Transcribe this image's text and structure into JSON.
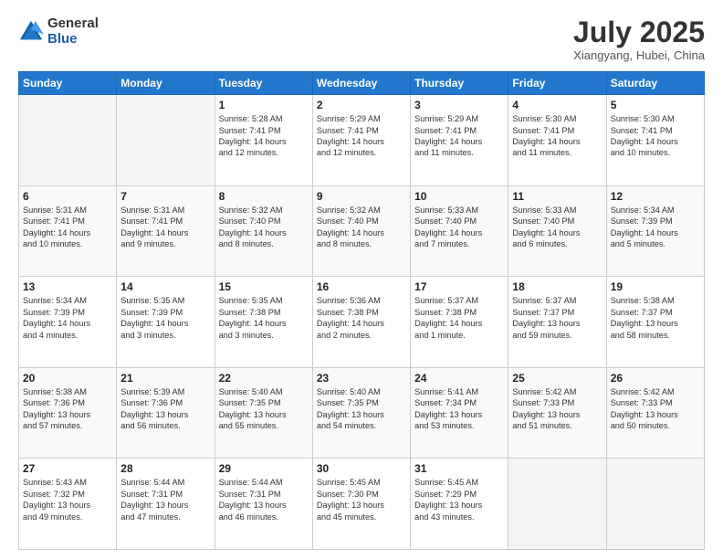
{
  "logo": {
    "general": "General",
    "blue": "Blue"
  },
  "header": {
    "month": "July 2025",
    "location": "Xiangyang, Hubei, China"
  },
  "weekdays": [
    "Sunday",
    "Monday",
    "Tuesday",
    "Wednesday",
    "Thursday",
    "Friday",
    "Saturday"
  ],
  "weeks": [
    [
      {
        "day": "",
        "info": ""
      },
      {
        "day": "",
        "info": ""
      },
      {
        "day": "1",
        "info": "Sunrise: 5:28 AM\nSunset: 7:41 PM\nDaylight: 14 hours\nand 12 minutes."
      },
      {
        "day": "2",
        "info": "Sunrise: 5:29 AM\nSunset: 7:41 PM\nDaylight: 14 hours\nand 12 minutes."
      },
      {
        "day": "3",
        "info": "Sunrise: 5:29 AM\nSunset: 7:41 PM\nDaylight: 14 hours\nand 11 minutes."
      },
      {
        "day": "4",
        "info": "Sunrise: 5:30 AM\nSunset: 7:41 PM\nDaylight: 14 hours\nand 11 minutes."
      },
      {
        "day": "5",
        "info": "Sunrise: 5:30 AM\nSunset: 7:41 PM\nDaylight: 14 hours\nand 10 minutes."
      }
    ],
    [
      {
        "day": "6",
        "info": "Sunrise: 5:31 AM\nSunset: 7:41 PM\nDaylight: 14 hours\nand 10 minutes."
      },
      {
        "day": "7",
        "info": "Sunrise: 5:31 AM\nSunset: 7:41 PM\nDaylight: 14 hours\nand 9 minutes."
      },
      {
        "day": "8",
        "info": "Sunrise: 5:32 AM\nSunset: 7:40 PM\nDaylight: 14 hours\nand 8 minutes."
      },
      {
        "day": "9",
        "info": "Sunrise: 5:32 AM\nSunset: 7:40 PM\nDaylight: 14 hours\nand 8 minutes."
      },
      {
        "day": "10",
        "info": "Sunrise: 5:33 AM\nSunset: 7:40 PM\nDaylight: 14 hours\nand 7 minutes."
      },
      {
        "day": "11",
        "info": "Sunrise: 5:33 AM\nSunset: 7:40 PM\nDaylight: 14 hours\nand 6 minutes."
      },
      {
        "day": "12",
        "info": "Sunrise: 5:34 AM\nSunset: 7:39 PM\nDaylight: 14 hours\nand 5 minutes."
      }
    ],
    [
      {
        "day": "13",
        "info": "Sunrise: 5:34 AM\nSunset: 7:39 PM\nDaylight: 14 hours\nand 4 minutes."
      },
      {
        "day": "14",
        "info": "Sunrise: 5:35 AM\nSunset: 7:39 PM\nDaylight: 14 hours\nand 3 minutes."
      },
      {
        "day": "15",
        "info": "Sunrise: 5:35 AM\nSunset: 7:38 PM\nDaylight: 14 hours\nand 3 minutes."
      },
      {
        "day": "16",
        "info": "Sunrise: 5:36 AM\nSunset: 7:38 PM\nDaylight: 14 hours\nand 2 minutes."
      },
      {
        "day": "17",
        "info": "Sunrise: 5:37 AM\nSunset: 7:38 PM\nDaylight: 14 hours\nand 1 minute."
      },
      {
        "day": "18",
        "info": "Sunrise: 5:37 AM\nSunset: 7:37 PM\nDaylight: 13 hours\nand 59 minutes."
      },
      {
        "day": "19",
        "info": "Sunrise: 5:38 AM\nSunset: 7:37 PM\nDaylight: 13 hours\nand 58 minutes."
      }
    ],
    [
      {
        "day": "20",
        "info": "Sunrise: 5:38 AM\nSunset: 7:36 PM\nDaylight: 13 hours\nand 57 minutes."
      },
      {
        "day": "21",
        "info": "Sunrise: 5:39 AM\nSunset: 7:36 PM\nDaylight: 13 hours\nand 56 minutes."
      },
      {
        "day": "22",
        "info": "Sunrise: 5:40 AM\nSunset: 7:35 PM\nDaylight: 13 hours\nand 55 minutes."
      },
      {
        "day": "23",
        "info": "Sunrise: 5:40 AM\nSunset: 7:35 PM\nDaylight: 13 hours\nand 54 minutes."
      },
      {
        "day": "24",
        "info": "Sunrise: 5:41 AM\nSunset: 7:34 PM\nDaylight: 13 hours\nand 53 minutes."
      },
      {
        "day": "25",
        "info": "Sunrise: 5:42 AM\nSunset: 7:33 PM\nDaylight: 13 hours\nand 51 minutes."
      },
      {
        "day": "26",
        "info": "Sunrise: 5:42 AM\nSunset: 7:33 PM\nDaylight: 13 hours\nand 50 minutes."
      }
    ],
    [
      {
        "day": "27",
        "info": "Sunrise: 5:43 AM\nSunset: 7:32 PM\nDaylight: 13 hours\nand 49 minutes."
      },
      {
        "day": "28",
        "info": "Sunrise: 5:44 AM\nSunset: 7:31 PM\nDaylight: 13 hours\nand 47 minutes."
      },
      {
        "day": "29",
        "info": "Sunrise: 5:44 AM\nSunset: 7:31 PM\nDaylight: 13 hours\nand 46 minutes."
      },
      {
        "day": "30",
        "info": "Sunrise: 5:45 AM\nSunset: 7:30 PM\nDaylight: 13 hours\nand 45 minutes."
      },
      {
        "day": "31",
        "info": "Sunrise: 5:45 AM\nSunset: 7:29 PM\nDaylight: 13 hours\nand 43 minutes."
      },
      {
        "day": "",
        "info": ""
      },
      {
        "day": "",
        "info": ""
      }
    ]
  ]
}
